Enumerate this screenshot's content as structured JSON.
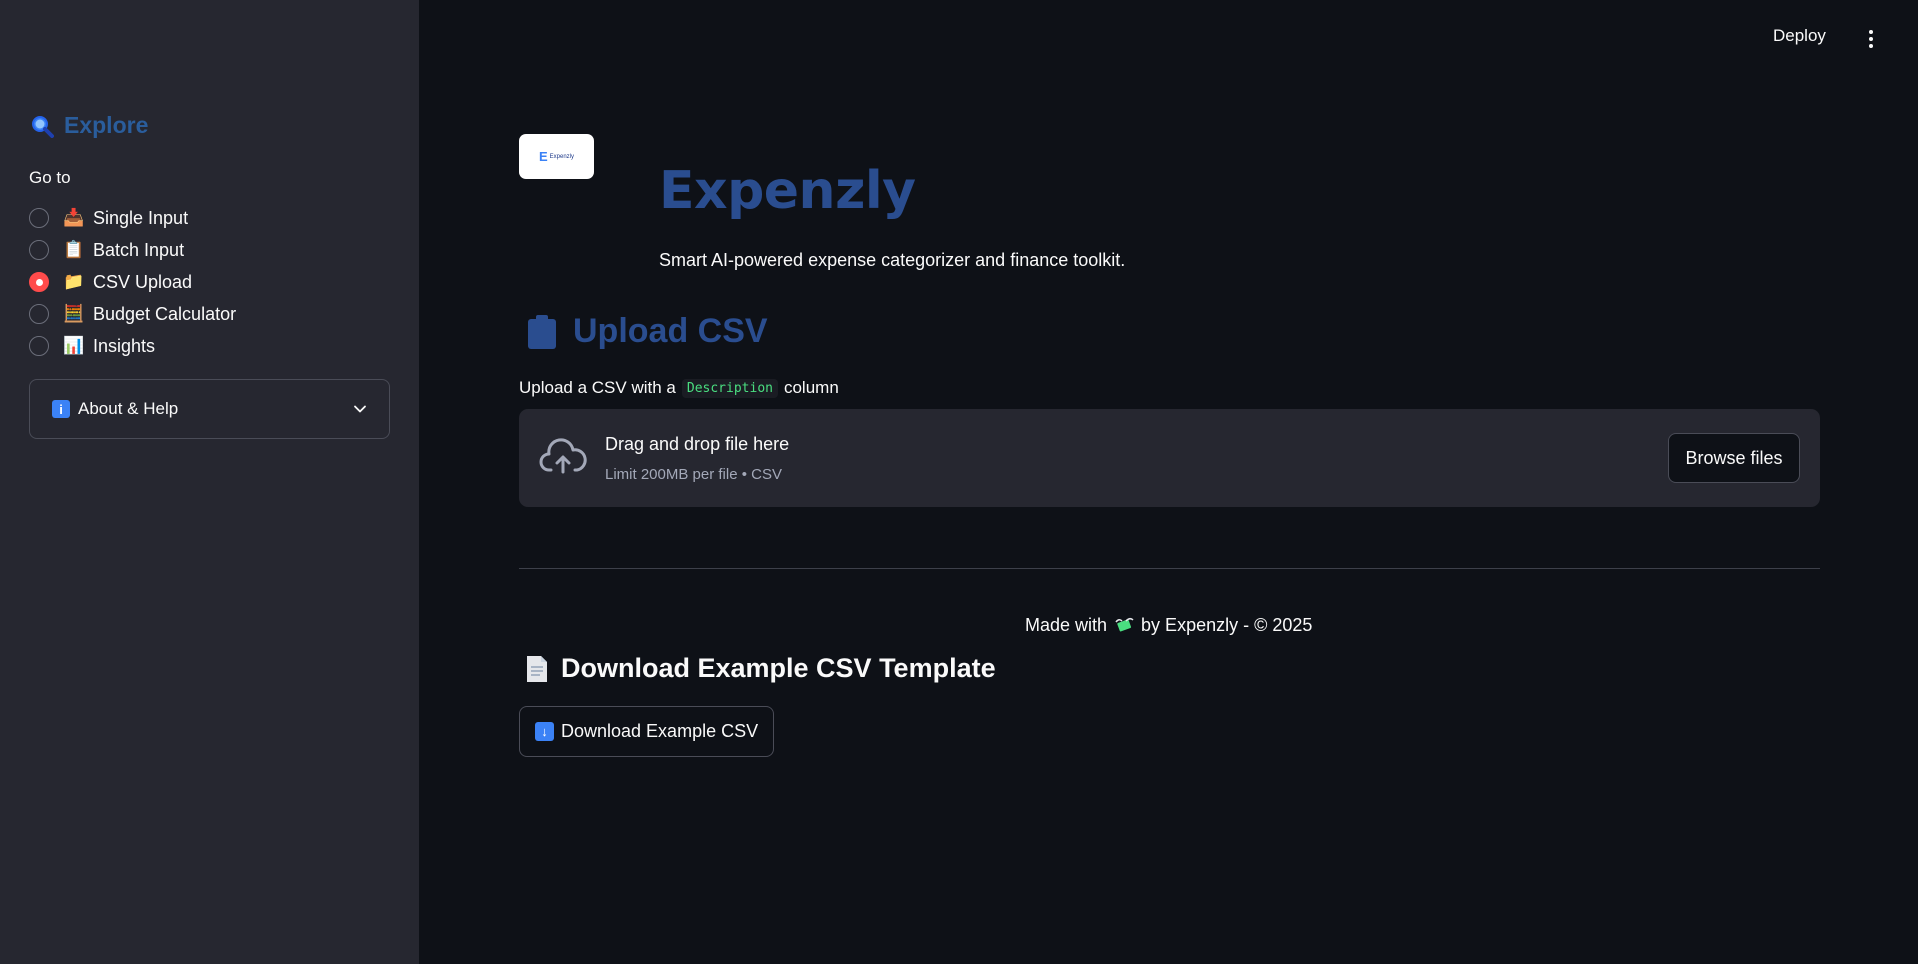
{
  "header": {
    "deploy_label": "Deploy",
    "menu_icon": "kebab-menu-icon"
  },
  "sidebar": {
    "title": "Explore",
    "title_icon": "magnifier-icon",
    "goto_label": "Go to",
    "nav_items": [
      {
        "label": "Single Input",
        "icon": "inbox-tray-icon",
        "emoji": "📥",
        "selected": false
      },
      {
        "label": "Batch Input",
        "icon": "clipboard-icon",
        "emoji": "📋",
        "selected": false
      },
      {
        "label": "CSV Upload",
        "icon": "folder-icon",
        "emoji": "📁",
        "selected": true
      },
      {
        "label": "Budget Calculator",
        "icon": "abacus-icon",
        "emoji": "🧮",
        "selected": false
      },
      {
        "label": "Insights",
        "icon": "bar-chart-icon",
        "emoji": "📊",
        "selected": false
      }
    ],
    "expander_label": "About & Help",
    "expander_icon": "info-icon"
  },
  "main": {
    "logo_text": "Expenzly",
    "app_title": "Expenzly",
    "app_subtitle": "Smart AI-powered expense categorizer and finance toolkit.",
    "section_title": "Upload CSV",
    "section_icon": "clipboard-icon",
    "upload_note_prefix": "Upload a CSV with a",
    "upload_note_code": "Description",
    "upload_note_suffix": "column",
    "dropzone": {
      "title": "Drag and drop file here",
      "subtitle": "Limit 200MB per file • CSV",
      "browse_label": "Browse files"
    },
    "footer": {
      "prefix": "Made with",
      "suffix": "by Expenzly - © 2025",
      "icon": "money-with-wings-icon"
    },
    "download_section_title": "Download Example CSV Template",
    "download_button_label": "Download Example CSV"
  },
  "colors": {
    "accent_blue": "#2a4d8f",
    "radio_selected": "#ff4b4b",
    "sidebar_bg": "#262730",
    "main_bg": "#0e1117"
  }
}
